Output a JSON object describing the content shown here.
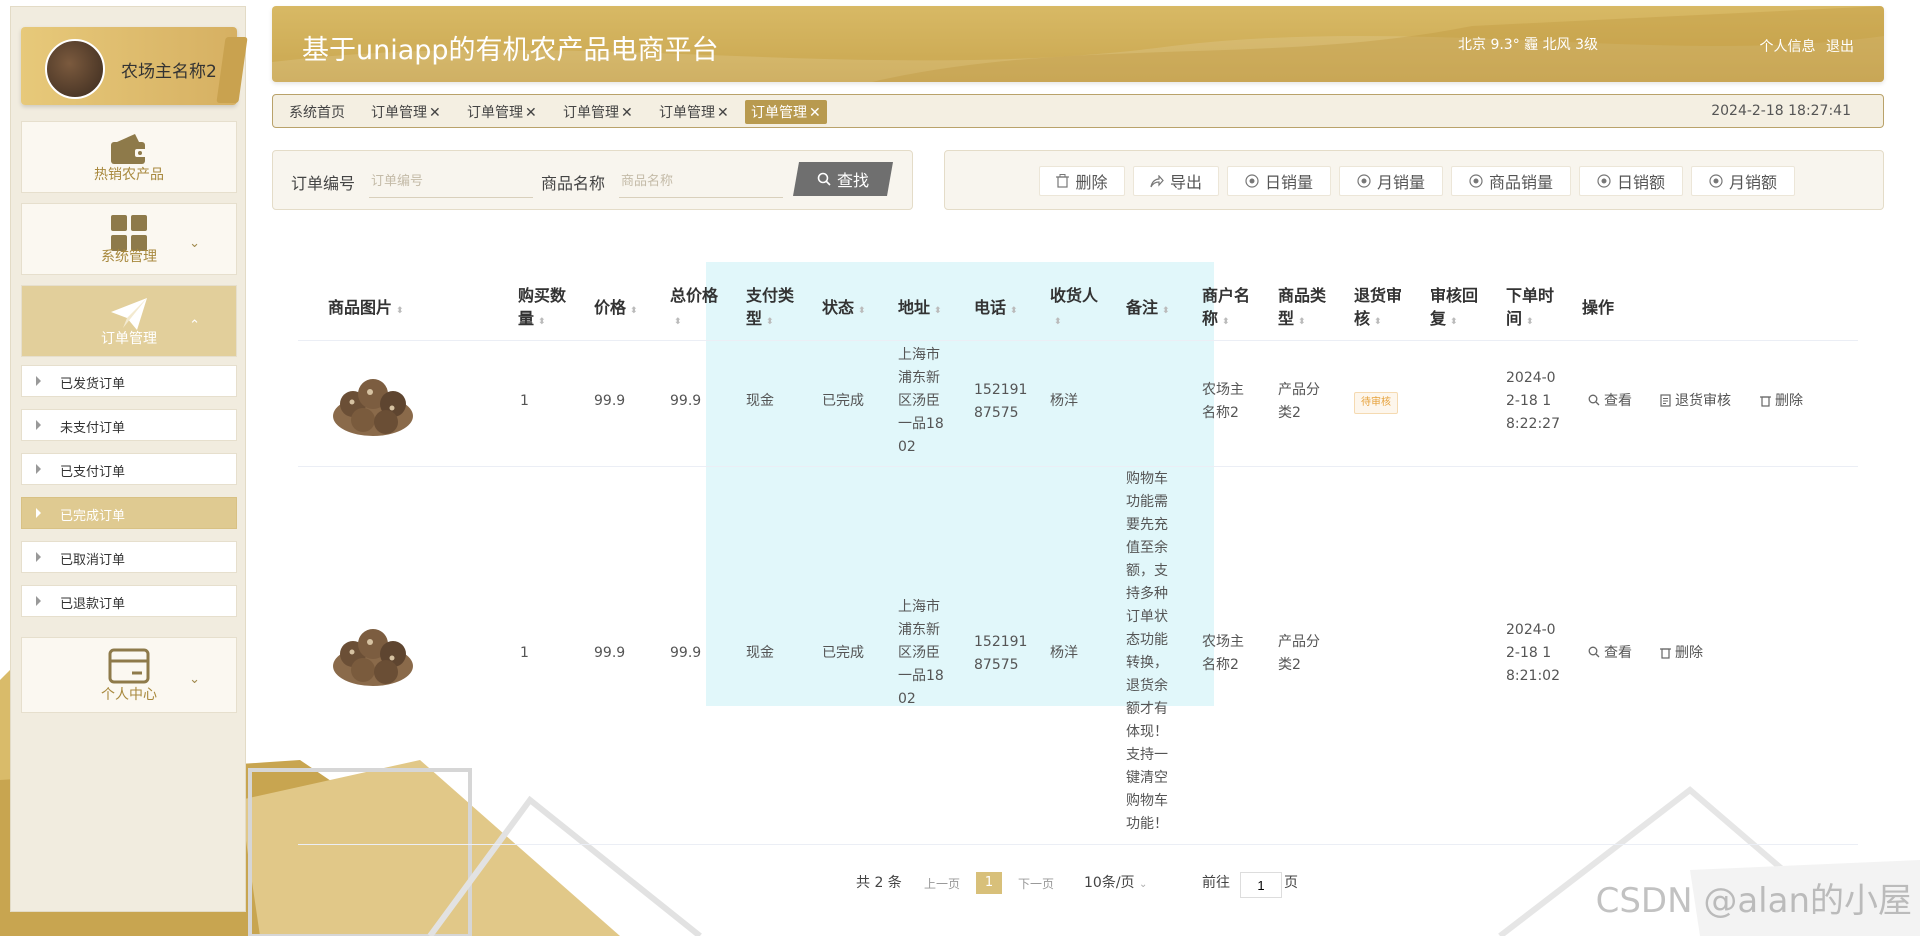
{
  "app": {
    "title": "基于uniapp的有机农产品电商平台",
    "weather": "北京 9.3° 霾 北风 3级",
    "profile_link": "个人信息",
    "logout_link": "退出"
  },
  "sidebar": {
    "profile_name": "农场主名称2",
    "menus": [
      {
        "label": "热销农产品",
        "icon": "wallet-icon"
      },
      {
        "label": "系统管理",
        "icon": "grid-icon"
      },
      {
        "label": "订单管理",
        "icon": "paper-plane-icon"
      },
      {
        "label": "个人中心",
        "icon": "card-icon"
      }
    ],
    "order_submenu": [
      {
        "label": "已发货订单"
      },
      {
        "label": "未支付订单"
      },
      {
        "label": "已支付订单"
      },
      {
        "label": "已完成订单"
      },
      {
        "label": "已取消订单"
      },
      {
        "label": "已退款订单"
      }
    ]
  },
  "tabs": {
    "items": [
      "系统首页",
      "订单管理",
      "订单管理",
      "订单管理",
      "订单管理",
      "订单管理"
    ],
    "close": "✕",
    "datetime": "2024-2-18 18:27:41"
  },
  "search": {
    "order_no_label": "订单编号",
    "order_no_placeholder": "订单编号",
    "product_label": "商品名称",
    "product_placeholder": "商品名称",
    "button": "查找"
  },
  "actions": {
    "delete": "删除",
    "export": "导出",
    "daily_sales": "日销量",
    "monthly_sales": "月销量",
    "product_sales": "商品销量",
    "daily_amount": "日销额",
    "monthly_amount": "月销额"
  },
  "table": {
    "headers": {
      "image": "商品图片",
      "qty_a": "购买数",
      "qty_b": "量",
      "price": "价格",
      "total_a": "总价格",
      "paytype_a": "支付类",
      "paytype_b": "型",
      "status": "状态",
      "address": "地址",
      "phone": "电话",
      "receiver_a": "收货人",
      "remark": "备注",
      "merchant_a": "商户名",
      "merchant_b": "称",
      "category_a": "商品类",
      "category_b": "型",
      "refund_a": "退货审",
      "refund_b": "核",
      "reply_a": "审核回",
      "reply_b": "复",
      "time_a": "下单时",
      "time_b": "间",
      "ops": "操作"
    },
    "rows": [
      {
        "qty": "1",
        "price": "99.9",
        "total": "99.9",
        "pay_type": "现金",
        "status": "已完成",
        "address": [
          "上海市",
          "浦东新",
          "区汤臣",
          "一品18",
          "02"
        ],
        "phone": [
          "152191",
          "87575"
        ],
        "receiver": "杨洋",
        "remark": [],
        "merchant": [
          "农场主",
          "名称2"
        ],
        "category": [
          "产品分",
          "类2"
        ],
        "refund": "待审核",
        "time": [
          "2024-0",
          "2-18 1",
          "8:22:27"
        ],
        "ops": {
          "view": "查看",
          "refund": "退货审核",
          "delete": "删除"
        }
      },
      {
        "qty": "1",
        "price": "99.9",
        "total": "99.9",
        "pay_type": "现金",
        "status": "已完成",
        "address": [
          "上海市",
          "浦东新",
          "区汤臣",
          "一品18",
          "02"
        ],
        "phone": [
          "152191",
          "87575"
        ],
        "receiver": "杨洋",
        "remark": [
          "购物车",
          "功能需",
          "要先充",
          "值至余",
          "额，支",
          "持多种",
          "订单状",
          "态功能",
          "转换，",
          "退货余",
          "额才有",
          "体现！",
          "支持一",
          "键清空",
          "购物车",
          "功能！"
        ],
        "merchant": [
          "农场主",
          "名称2"
        ],
        "category": [
          "产品分",
          "类2"
        ],
        "time": [
          "2024-0",
          "2-18 1",
          "8:21:02"
        ],
        "ops": {
          "view": "查看",
          "delete": "删除"
        }
      }
    ]
  },
  "pagination": {
    "total": "共 2 条",
    "prev": "上一页",
    "page": "1",
    "next": "下一页",
    "page_size": "10条/页",
    "goto_label": "前往",
    "goto_value": "1",
    "goto_unit": "页"
  },
  "watermark": "CSDN @alan的小屋",
  "colors": {
    "accent": "#c9a64f",
    "sidebar_bg": "#f1ecdf",
    "active_sub": "#dfca91"
  }
}
